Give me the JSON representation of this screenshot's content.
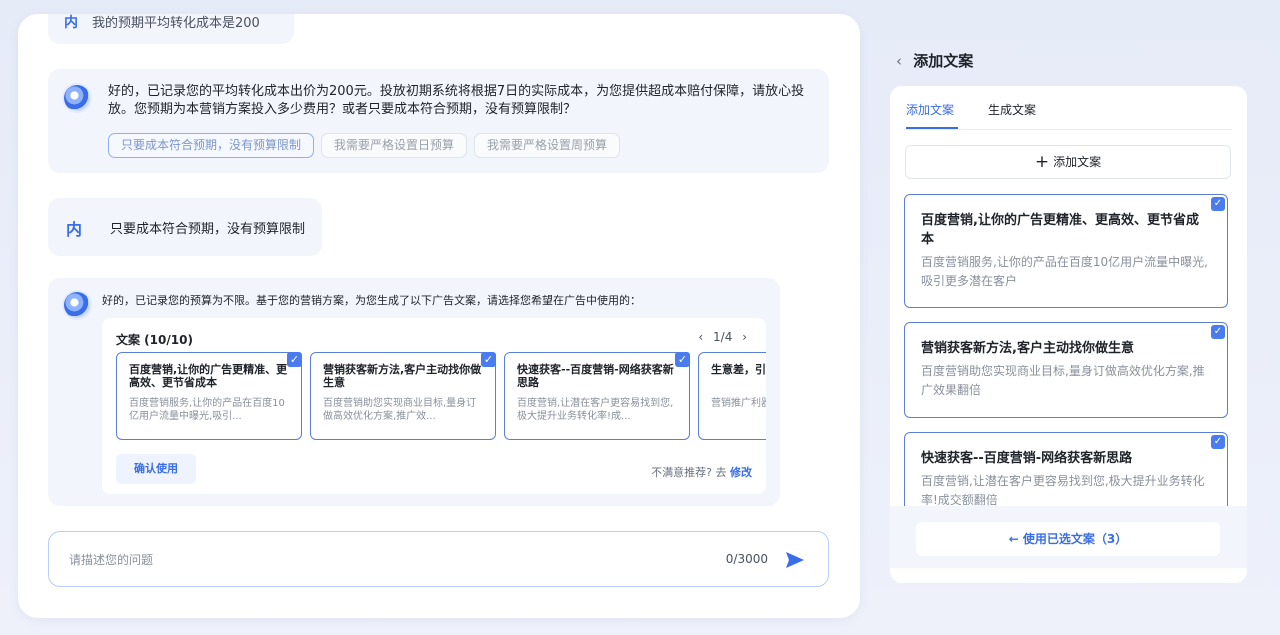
{
  "chat": {
    "top_user_message": "我的预期平均转化成本是200",
    "top_user_avatar": "内",
    "bot_message_1": "好的，已记录您的平均转化成本出价为200元。投放初期系统将根据7日的实际成本，为您提供超成本赔付保障，请放心投放。您预期为本营销方案投入多少费用？或者只要成本符合预期，没有预算限制？",
    "chips": [
      "只要成本符合预期，没有预算限制",
      "我需要严格设置日预算",
      "我需要严格设置周预算"
    ],
    "user_avatar": "内",
    "user_message_2": "只要成本符合预期，没有预算限制",
    "bot_message_2": "好的，已记录您的预算为不限。基于您的营销方案，为您生成了以下广告文案，请选择您希望在广告中使用的：",
    "copy_card": {
      "title": "文案 (10/10)",
      "pager_prev": "‹",
      "pager": "1/4",
      "pager_next": "›",
      "items": [
        {
          "title": "百度营销,让你的广告更精准、更高效、更节省成本",
          "desc": "百度营销服务,让你的产品在百度10亿用户流量中曝光,吸引..."
        },
        {
          "title": "营销获客新方法,客户主动找你做生意",
          "desc": "百度营销助您实现商业目标,量身订做高效优化方案,推广效..."
        },
        {
          "title": "快速获客--百度营销-网络获客新思路",
          "desc": "百度营销,让潜在客户更容易找到您,极大提升业务转化率!成..."
        },
        {
          "title": "生意差，引流推广",
          "desc": "营销推广利器,专业..."
        }
      ],
      "confirm": "确认使用",
      "dissatisfied": "不满意推荐? 去",
      "modify": "修改"
    },
    "input": {
      "placeholder": "请描述您的问题",
      "counter": "0/3000"
    }
  },
  "side": {
    "back": "‹",
    "title": "添加文案",
    "tabs": [
      "添加文案",
      "生成文案"
    ],
    "add_button": "添加文案",
    "items": [
      {
        "title": "百度营销,让你的广告更精准、更高效、更节省成本",
        "desc": "百度营销服务,让你的产品在百度10亿用户流量中曝光,吸引更多潜在客户"
      },
      {
        "title": "营销获客新方法,客户主动找你做生意",
        "desc": "百度营销助您实现商业目标,量身订做高效优化方案,推广效果翻倍"
      },
      {
        "title": "快速获客--百度营销-网络获客新思路",
        "desc": "百度营销,让潜在客户更容易找到您,极大提升业务转化率!成交额翻倍"
      }
    ],
    "use_button": "← 使用已选文案（3）"
  },
  "colors": {
    "accent": "#3a6ee8",
    "selected_border": "#5b7fd6",
    "bubble_bg": "#f2f5fc"
  },
  "icons": [
    "bot-avatar-icon",
    "check-icon",
    "send-icon",
    "back-arrow-icon",
    "plus-icon"
  ]
}
